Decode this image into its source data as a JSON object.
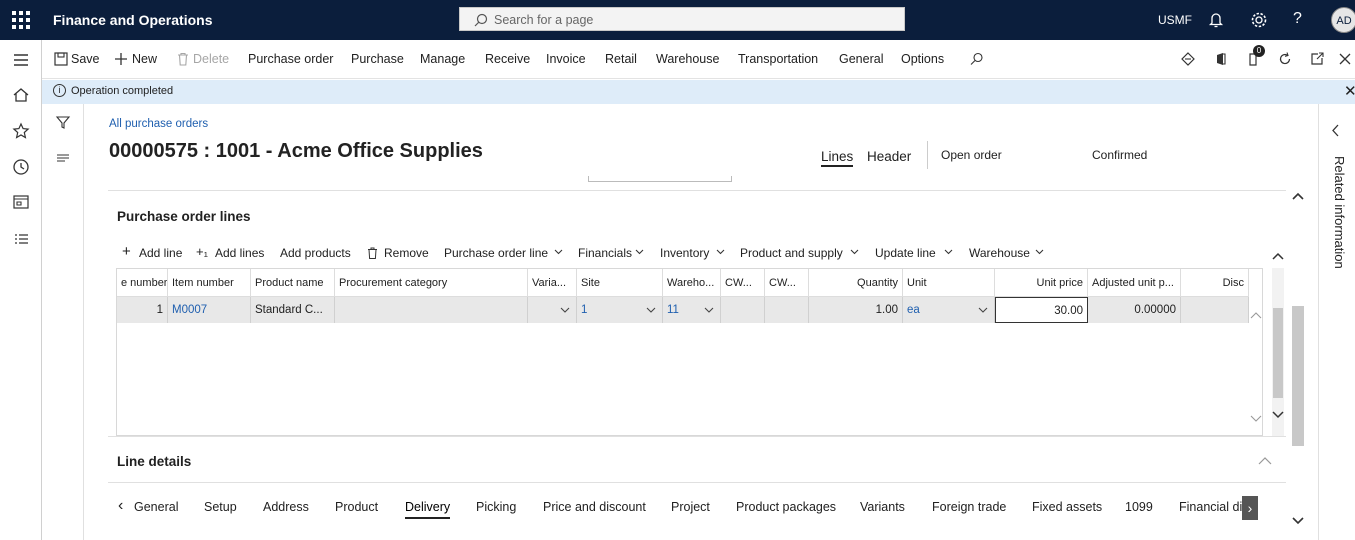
{
  "topbar": {
    "app_name": "Finance and Operations",
    "search_placeholder": "Search for a page",
    "company": "USMF",
    "user_initials": "AD",
    "help_label": "?"
  },
  "actionbar": {
    "save": "Save",
    "new": "New",
    "delete": "Delete",
    "menus": [
      "Purchase order",
      "Purchase",
      "Manage",
      "Receive",
      "Invoice",
      "Retail",
      "Warehouse",
      "Transportation",
      "General",
      "Options"
    ],
    "attachments_count": "0"
  },
  "message": {
    "text": "Operation completed"
  },
  "record": {
    "breadcrumb": "All purchase orders",
    "title": "00000575 : 1001 - Acme Office Supplies",
    "view_tabs": [
      "Lines",
      "Header"
    ],
    "active_view": "Lines",
    "approval_status": "Open order",
    "document_status": "Confirmed"
  },
  "po_lines": {
    "section_title": "Purchase order lines",
    "toolbar": [
      "Add line",
      "Add lines",
      "Add products",
      "Remove",
      "Purchase order line",
      "Financials",
      "Inventory",
      "Product and supply",
      "Update line",
      "Warehouse"
    ],
    "columns": [
      "e number",
      "Item number",
      "Product name",
      "Procurement category",
      "Varia...",
      "Site",
      "Wareho...",
      "CW...",
      "CW...",
      "Quantity",
      "Unit",
      "Unit price",
      "Adjusted unit p...",
      "Disc"
    ],
    "rows": [
      {
        "line_number": "1",
        "item_number": "M0007",
        "product_name": "Standard C...",
        "procurement_category": "",
        "variant": "",
        "site": "1",
        "warehouse": "11",
        "cw1": "",
        "cw2": "",
        "quantity": "1.00",
        "unit": "ea",
        "unit_price": "30.00",
        "adjusted_unit_price": "0.00000",
        "discount": ""
      }
    ]
  },
  "line_details": {
    "section_title": "Line details",
    "tabs": [
      "General",
      "Setup",
      "Address",
      "Product",
      "Delivery",
      "Picking",
      "Price and discount",
      "Project",
      "Product packages",
      "Variants",
      "Foreign trade",
      "Fixed assets",
      "1099",
      "Financial dir"
    ],
    "active_tab": "Delivery"
  },
  "related": {
    "label": "Related information"
  },
  "colors": {
    "topbar": "#0b1e3c",
    "message_bar": "#deecf9",
    "link": "#1f5faf"
  }
}
